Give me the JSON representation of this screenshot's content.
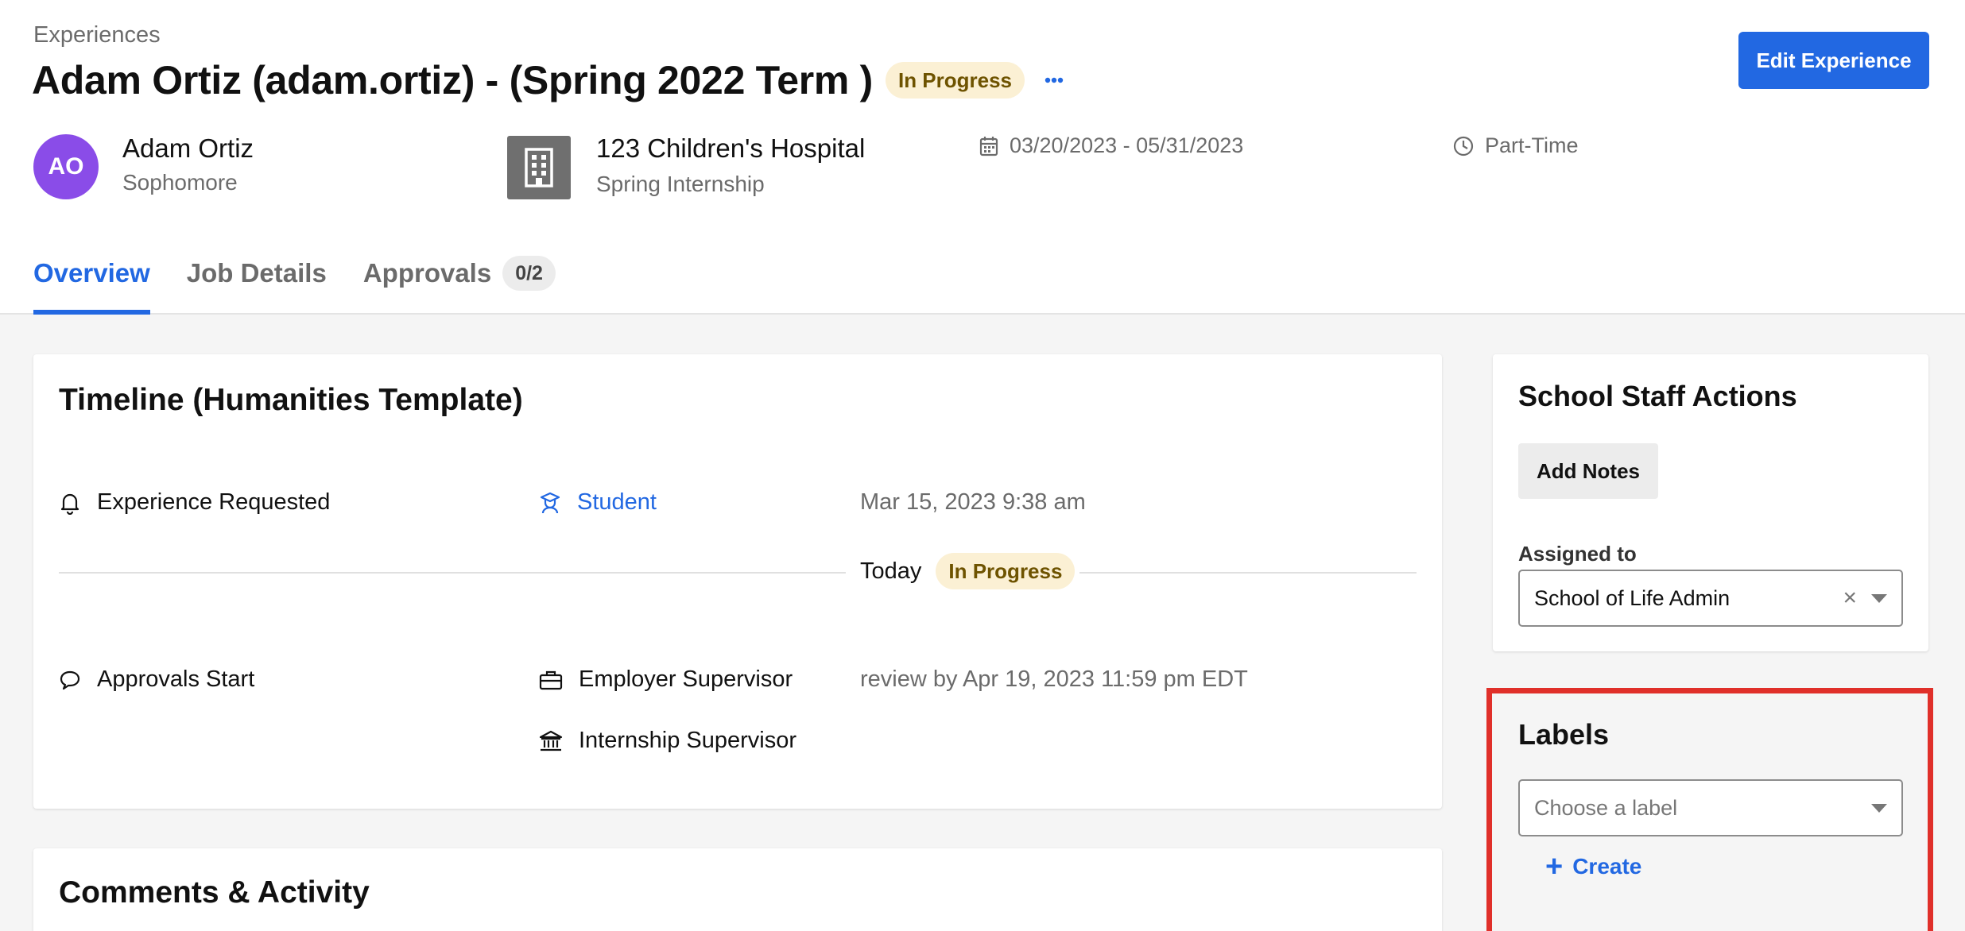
{
  "breadcrumb": "Experiences",
  "title": "Adam Ortiz (adam.ortiz) - (Spring 2022 Term )",
  "status_badge": "In Progress",
  "edit_button": "Edit Experience",
  "student": {
    "initials": "AO",
    "name": "Adam Ortiz",
    "year": "Sophomore"
  },
  "employer": {
    "name": "123 Children's Hospital",
    "program": "Spring Internship"
  },
  "date_range": "03/20/2023 - 05/31/2023",
  "schedule": "Part-Time",
  "tabs": [
    {
      "label": "Overview",
      "active": true
    },
    {
      "label": "Job Details"
    },
    {
      "label": "Approvals",
      "count": "0/2"
    }
  ],
  "timeline": {
    "title": "Timeline (Humanities Template)",
    "requested": {
      "label": "Experience Requested",
      "actor": "Student",
      "date": "Mar 15, 2023 9:38 am"
    },
    "today": {
      "label": "Today",
      "badge": "In Progress"
    },
    "approvals": {
      "label": "Approvals Start",
      "approver1": "Employer Supervisor",
      "approver2": "Internship Supervisor",
      "due": "review by Apr 19, 2023 11:59 pm EDT"
    }
  },
  "comments": {
    "title": "Comments & Activity"
  },
  "staff_actions": {
    "title": "School Staff Actions",
    "add_notes": "Add Notes",
    "assigned_label": "Assigned to",
    "assigned_value": "School of Life Admin"
  },
  "labels": {
    "title": "Labels",
    "placeholder": "Choose a label",
    "create": "Create"
  },
  "colors": {
    "accent": "#2268e2",
    "avatar": "#8a4ce8",
    "badge_bg": "#fbf0d4",
    "highlight": "#e0302a"
  }
}
